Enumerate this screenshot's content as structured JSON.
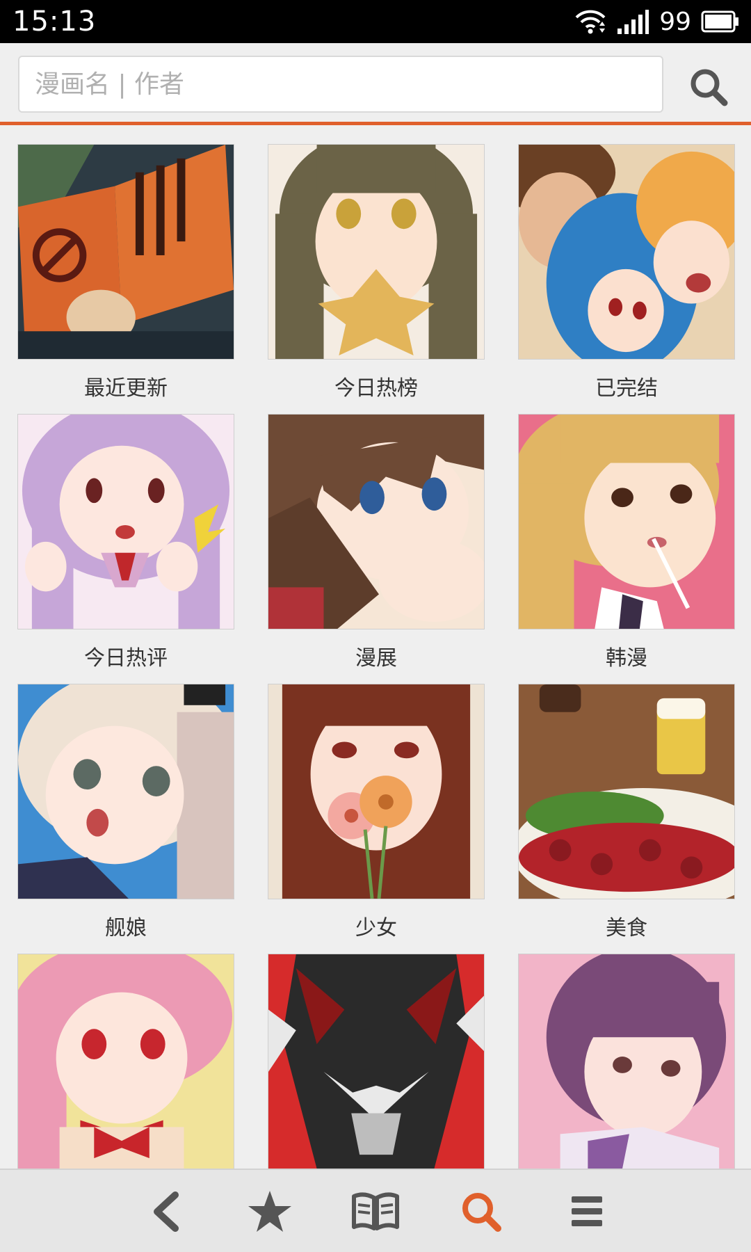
{
  "status_bar": {
    "time": "15:13",
    "battery_level": "99",
    "icons": [
      "wifi-icon",
      "signal-icon",
      "battery-icon"
    ]
  },
  "search": {
    "placeholder": "漫画名 | 作者",
    "value": "",
    "button_icon": "search-icon"
  },
  "colors": {
    "accent": "#e0602c",
    "background": "#efefef",
    "nav_background": "#e6e6e6",
    "icon_gray": "#555555"
  },
  "categories": [
    {
      "label": "最近更新"
    },
    {
      "label": "今日热榜"
    },
    {
      "label": "已完结"
    },
    {
      "label": "今日热评"
    },
    {
      "label": "漫展"
    },
    {
      "label": "韩漫"
    },
    {
      "label": "舰娘"
    },
    {
      "label": "少女"
    },
    {
      "label": "美食"
    },
    {
      "label": ""
    },
    {
      "label": ""
    },
    {
      "label": ""
    }
  ],
  "bottom_nav": [
    {
      "icon": "back-icon",
      "active": false
    },
    {
      "icon": "star-icon",
      "active": false
    },
    {
      "icon": "book-icon",
      "active": false
    },
    {
      "icon": "search-icon",
      "active": true
    },
    {
      "icon": "menu-icon",
      "active": false
    }
  ]
}
